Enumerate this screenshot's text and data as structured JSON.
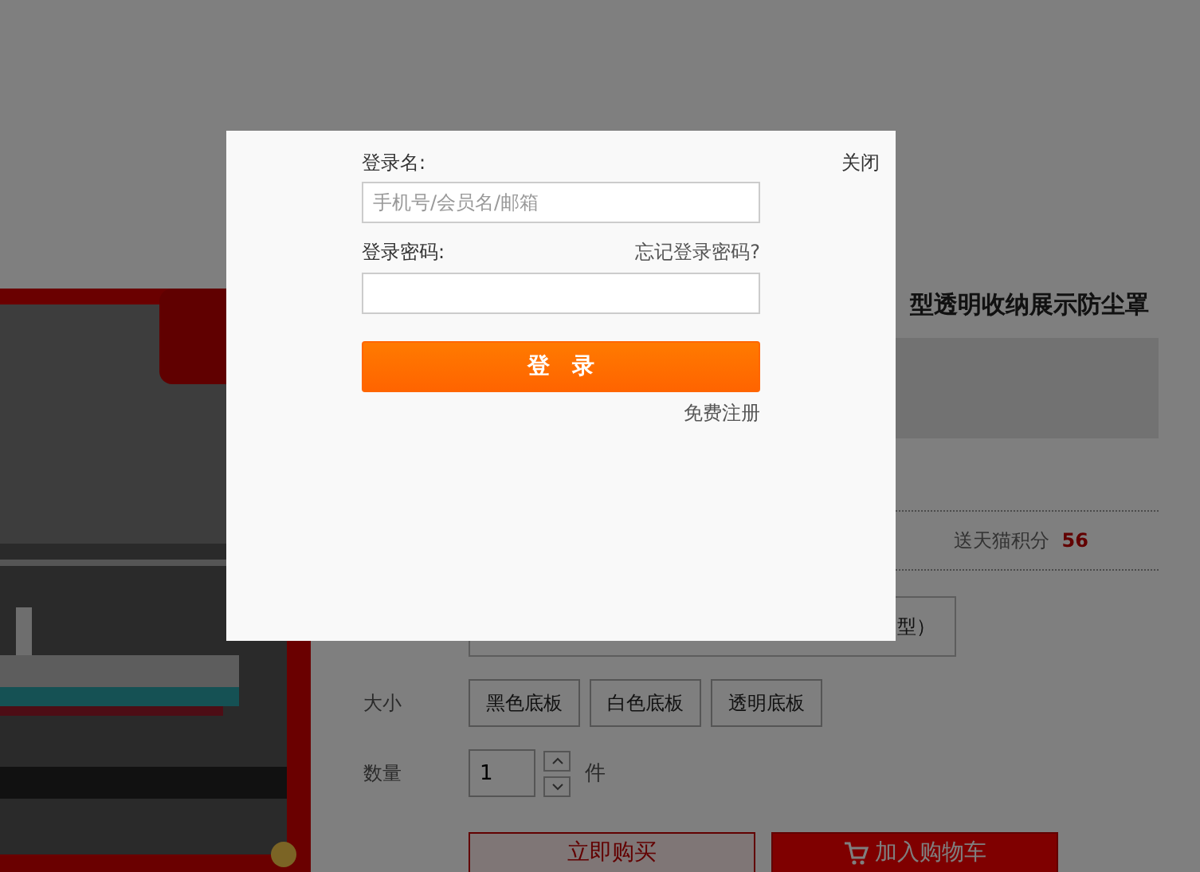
{
  "product": {
    "title": "型透明收纳展示防尘罩",
    "points_label": "送天猫积分",
    "points": "56",
    "option_partial": "型）",
    "size": {
      "label": "大小",
      "options": [
        {
          "label": "黑色底板"
        },
        {
          "label": "白色底板"
        },
        {
          "label": "透明底板"
        }
      ]
    },
    "quantity": {
      "label": "数量",
      "value": "1",
      "unit": "件"
    },
    "buttons": {
      "buy_now": "立即购买",
      "add_to_cart": "加入购物车"
    }
  },
  "login_dialog": {
    "close": "关闭",
    "username_label": "登录名:",
    "username_placeholder": "手机号/会员名/邮箱",
    "password_label": "登录密码:",
    "forgot_link": "忘记登录密码?",
    "submit": "登　录",
    "register_link": "免费注册"
  }
}
